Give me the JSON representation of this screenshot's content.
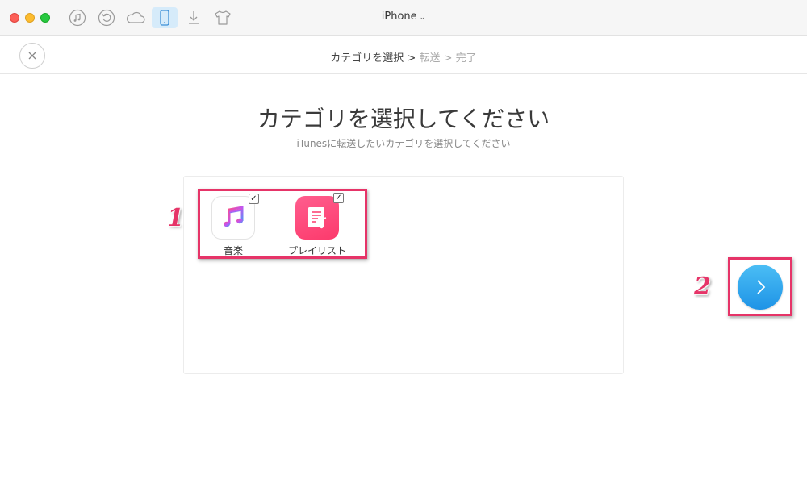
{
  "window": {
    "device_title": "iPhone",
    "device_chevron": "⌄"
  },
  "toolbar": {
    "icons": [
      "music-note-icon",
      "restore-icon",
      "cloud-icon",
      "phone-icon",
      "download-icon",
      "tshirt-icon"
    ],
    "active": "phone-icon"
  },
  "breadcrumb": {
    "step1": "カテゴリを選択",
    "sep1": " > ",
    "step2": "転送",
    "sep2": " > ",
    "step3": "完了"
  },
  "main": {
    "title": "カテゴリを選択してください",
    "subtitle": "iTunesに転送したいカテゴリを選択してください"
  },
  "categories": [
    {
      "label": "音楽",
      "icon": "music-app-icon",
      "checked": true,
      "check": "✓"
    },
    {
      "label": "プレイリスト",
      "icon": "playlist-icon",
      "checked": true,
      "check": "✓"
    }
  ],
  "annotations": {
    "one": "1",
    "two": "2"
  },
  "colors": {
    "accent": "#1e93e6",
    "annotation": "#e63468",
    "playlist": "#fc3a6c"
  }
}
